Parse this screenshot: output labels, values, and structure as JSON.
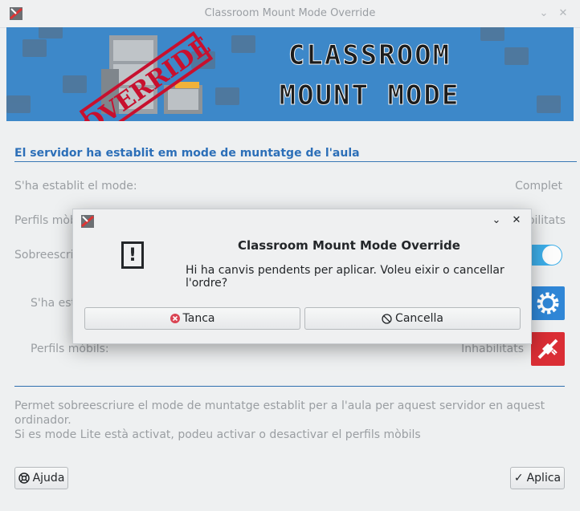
{
  "window": {
    "title": "Classroom Mount Mode Override",
    "minimize_glyph": "⌄",
    "close_glyph": "✕"
  },
  "banner": {
    "stamp_text": "OVERRIDE",
    "title_line1": "CLASSROOM",
    "title_line2": "MOUNT MODE"
  },
  "section": {
    "heading": "El servidor ha establit em mode de muntatge de l'aula"
  },
  "rows": {
    "mode_label": "S'ha establit el mode:",
    "mode_value": "Complet",
    "profiles_label": "Perfils mòbils:",
    "profiles_value": "Inhabilitats",
    "override_label": "Sobreescriure",
    "local_mode_label": "S'ha establit el mode:",
    "local_profiles_label": "Perfils mòbils:",
    "local_profiles_value": "Inhabilitats"
  },
  "description": {
    "line1": "Permet sobreescriure el mode de muntatge establit per a l'aula per aquest servidor en aquest ordinador.",
    "line2": "Si es mode Lite està activat, podeu activar o desactivar el perfils mòbils"
  },
  "buttons": {
    "help_label": "Ajuda",
    "apply_label": "Aplica"
  },
  "dialog": {
    "title": "Classroom Mount Mode Override",
    "message": "Hi ha canvis pendents per aplicar. Voleu eixir o cancellar l'ordre?",
    "close_button_label": "Tanca",
    "cancel_button_label": "Cancella",
    "minimize_glyph": "⌄",
    "close_glyph": "✕"
  },
  "colors": {
    "accent": "#3daee9",
    "heading": "#2c6fb8",
    "danger_tile": "#da2e35",
    "settings_tile": "#2f86d6",
    "banner_bg": "#3d88c9"
  }
}
